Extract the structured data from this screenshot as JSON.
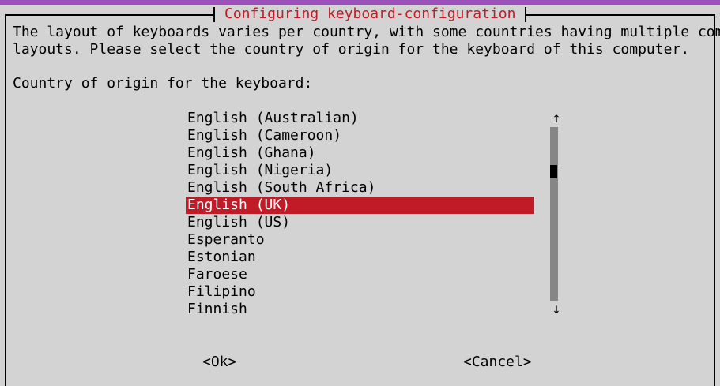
{
  "dialog": {
    "title": "Configuring keyboard-configuration",
    "description_line1": "The layout of keyboards varies per country, with some countries having multiple common",
    "description_line2": "layouts. Please select the country of origin for the keyboard of this computer.",
    "prompt": "Country of origin for the keyboard:"
  },
  "list": {
    "items": [
      "English (Australian)",
      "English (Cameroon)",
      "English (Ghana)",
      "English (Nigeria)",
      "English (South Africa)",
      "English (UK)",
      "English (US)",
      "Esperanto",
      "Estonian",
      "Faroese",
      "Filipino",
      "Finnish"
    ],
    "selected": "English (UK)"
  },
  "scrollbar": {
    "up_arrow": "↑",
    "down_arrow": "↓"
  },
  "buttons": {
    "ok": "<Ok>",
    "cancel": "<Cancel>"
  },
  "colors": {
    "background": "#d3d3d3",
    "accent_title": "#c01b26",
    "selection_bg": "#c01b26",
    "selection_fg": "#ffffff",
    "top_stripe": "#9b4fb8",
    "scroll_track": "#868686"
  }
}
